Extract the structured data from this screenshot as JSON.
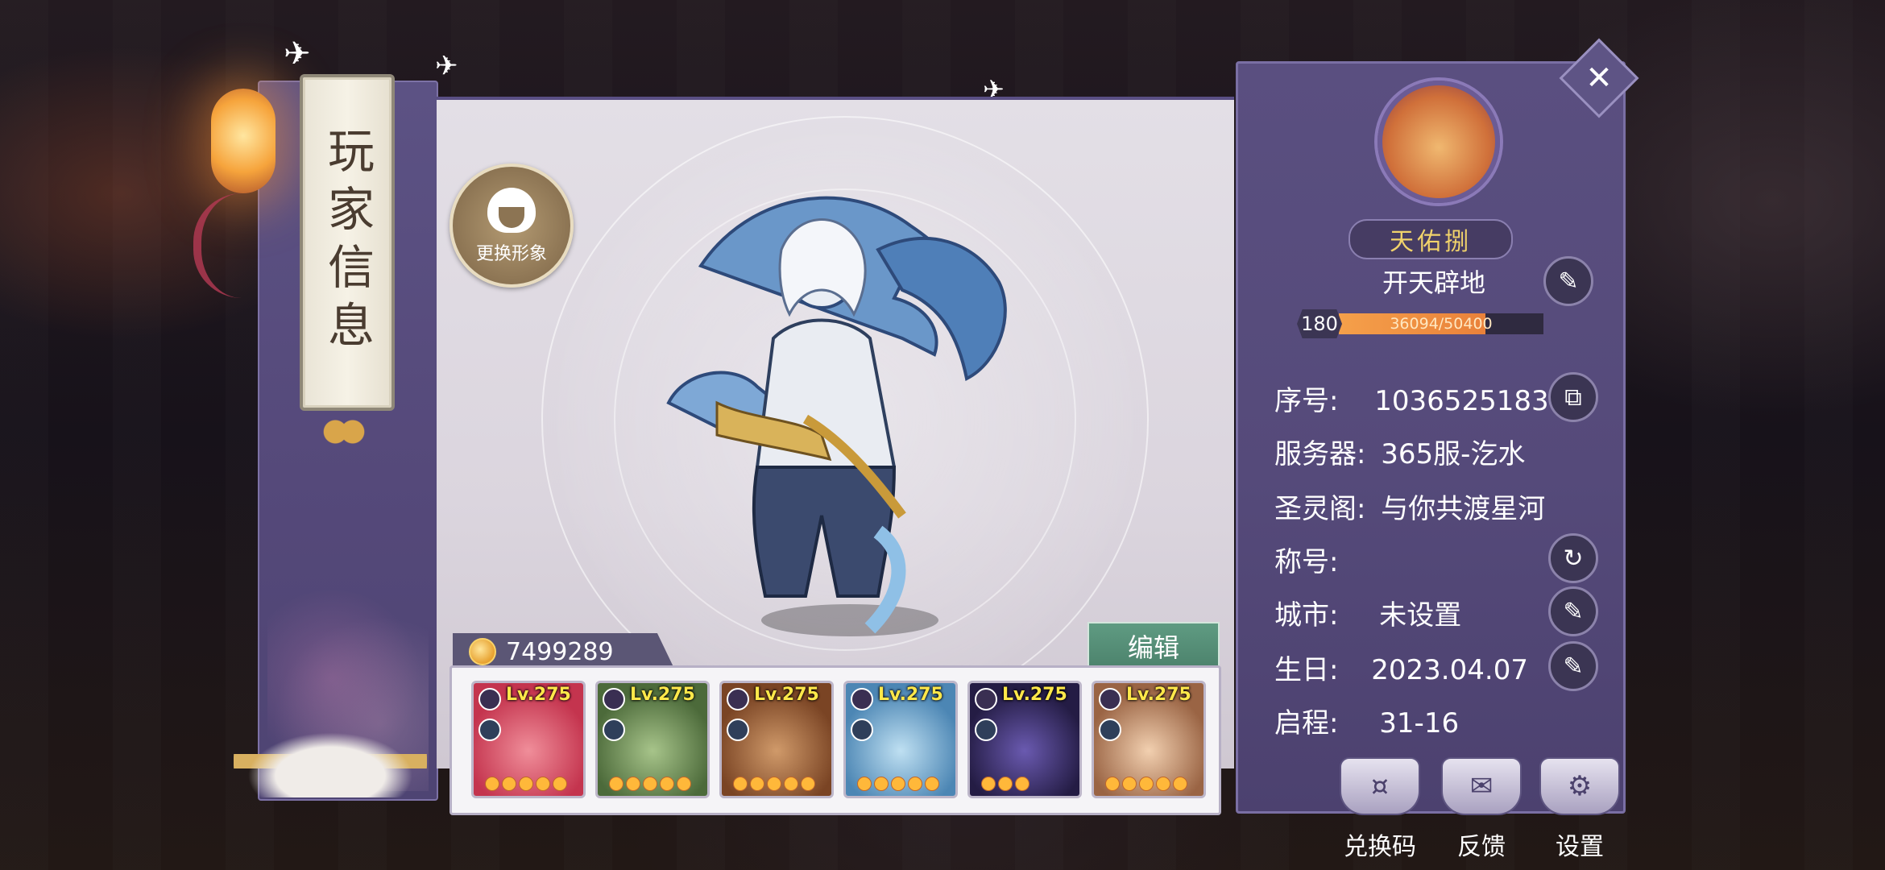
{
  "page": {
    "title": "玩家信息"
  },
  "left": {
    "change_avatar_label": "更换形象"
  },
  "currency": {
    "amount": "7499289"
  },
  "team": {
    "edit_label": "编辑",
    "heroes": [
      {
        "level": "Lv.275",
        "stars": 5,
        "bg": "#e8637a"
      },
      {
        "level": "Lv.275",
        "stars": 5,
        "bg": "#6f8c5a"
      },
      {
        "level": "Lv.275",
        "stars": 5,
        "bg": "#a0643a"
      },
      {
        "level": "Lv.275",
        "stars": 5,
        "bg": "#6aa5c8"
      },
      {
        "level": "Lv.275",
        "stars": 3,
        "bg": "#3d3568"
      },
      {
        "level": "Lv.275",
        "stars": 5,
        "bg": "#b88058"
      }
    ]
  },
  "profile": {
    "guild_name": "天佑捌",
    "title": "开天辟地",
    "level": "180",
    "exp_text": "36094/50400",
    "exp_fraction": 0.716,
    "rows": {
      "id_label": "序号:",
      "id_value": "10365251837",
      "server_label": "服务器:",
      "server_value": "365服-汔水",
      "shrine_label": "圣灵阁:",
      "shrine_value": "与你共渡星河",
      "nick_label": "称号:",
      "nick_value": "",
      "city_label": "城市:",
      "city_value": "未设置",
      "birthday_label": "生日:",
      "birthday_value": "2023.04.07",
      "journey_label": "启程:",
      "journey_value": "31-16"
    }
  },
  "bottom": {
    "redeem_label": "兑换码",
    "feedback_label": "反馈",
    "settings_label": "设置"
  }
}
